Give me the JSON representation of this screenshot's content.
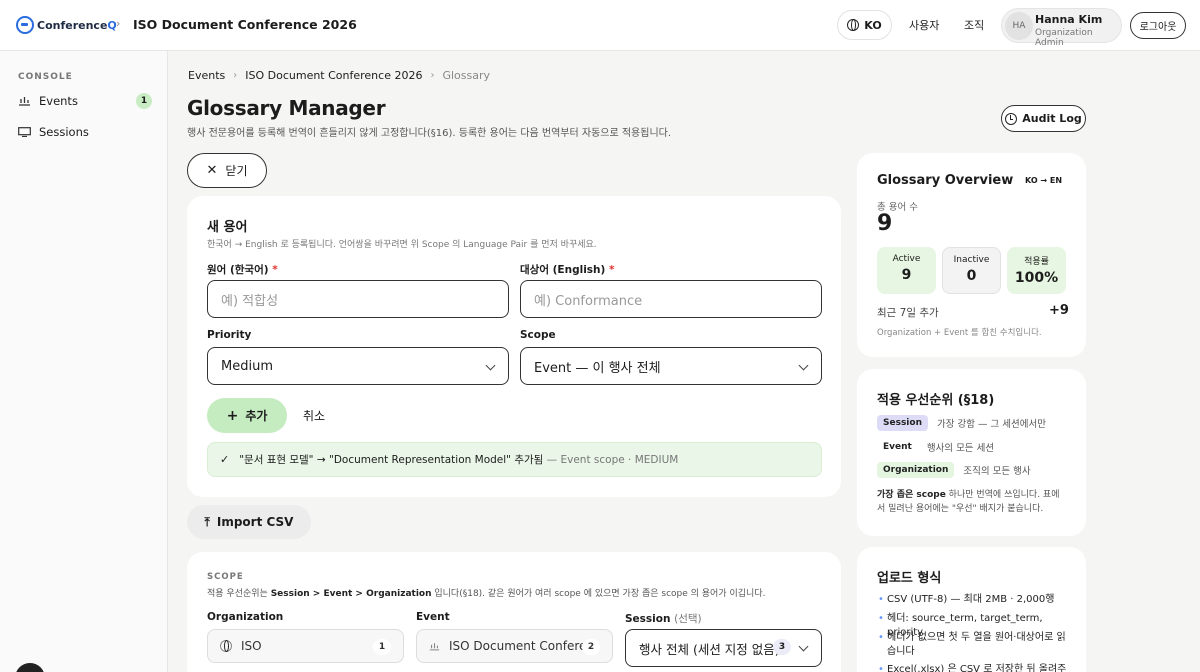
{
  "header": {
    "logo_main": "Conference",
    "logo_accent": "Q",
    "title": "ISO Document Conference 2026",
    "lang": "KO",
    "nav": [
      "사용자",
      "조직"
    ],
    "user": {
      "initials": "HA",
      "name": "Hanna Kim",
      "role": "Organization Admin"
    },
    "logout": "로그아웃"
  },
  "sidebar": {
    "heading": "CONSOLE",
    "items": [
      {
        "label": "Events",
        "badge": "1",
        "icon": "calendar-icon"
      },
      {
        "label": "Sessions",
        "icon": "monitor-icon"
      }
    ]
  },
  "breadcrumb": [
    "Events",
    "ISO Document Conference 2026",
    "Glossary"
  ],
  "page": {
    "title": "Glossary Manager",
    "subtitle": "행사 전문용어를 등록해 번역이 흔들리지 않게 고정합니다(§16). 등록한 용어는 다음 번역부터 자동으로 적용됩니다.",
    "audit_log": "Audit Log",
    "close": "닫기"
  },
  "new_term": {
    "title": "새 용어",
    "desc": "한국어 → English 로 등록됩니다. 언어쌍을 바꾸려면 위 Scope 의 Language Pair 를 먼저 바꾸세요.",
    "source_label": "원어 (한국어)",
    "source_placeholder": "예) 적합성",
    "target_label": "대상어 (English)",
    "target_placeholder": "예) Conformance",
    "required_mark": "*",
    "priority_label": "Priority",
    "priority_value": "Medium",
    "scope_label": "Scope",
    "scope_value": "Event — 이 행사 전체",
    "add": "추가",
    "cancel": "취소",
    "success": "\"문서 표현 모델\" → \"Document Representation Model\" 추가됨",
    "success_meta": "— Event scope · MEDIUM"
  },
  "import_csv": "Import CSV",
  "scope_section": {
    "heading": "SCOPE",
    "desc_prefix": "적용 우선순위는 ",
    "desc_bold": "Session > Event > Organization",
    "desc_suffix": " 입니다(§18). 같은 원어가 여러 scope 에 있으면 가장 좁은 scope 의 용어가 이깁니다.",
    "org_label": "Organization",
    "org_value": "ISO",
    "org_count": "1",
    "event_label": "Event",
    "event_value": "ISO Document Confere...",
    "event_count": "2",
    "session_label": "Session",
    "session_optional": "(선택)",
    "session_value": "행사 전체 (세션 지정 없음)",
    "session_count": "3"
  },
  "overview": {
    "title": "Glossary Overview",
    "pair": "KO → EN",
    "total_label": "총 용어 수",
    "total": "9",
    "stats": [
      {
        "label": "Active",
        "value": "9"
      },
      {
        "label": "Inactive",
        "value": "0"
      },
      {
        "label": "적용률",
        "value": "100%"
      }
    ],
    "recent_label": "최근 7일 추가",
    "recent_value": "+9",
    "note": "Organization + Event 를 합친 수치입니다."
  },
  "priority_panel": {
    "title": "적용 우선순위 (§18)",
    "rows": [
      {
        "tag": "Session",
        "desc": "가장 강함 — 그 세션에서만",
        "color": "#dcdcf7"
      },
      {
        "tag": "Event",
        "desc": "행사의 모든 세션",
        "color": "#ffffff"
      },
      {
        "tag": "Organization",
        "desc": "조직의 모든 행사",
        "color": "#e4f5e0"
      }
    ],
    "note_bold": "가장 좁은 scope",
    "note_rest": " 하나만 번역에 쓰입니다. 표에서 밀려난 용어에는 \"우선\" 배지가 붙습니다."
  },
  "upload_panel": {
    "title": "업로드 형식",
    "bullets": [
      "CSV (UTF-8) — 최대 2MB · 2,000행",
      "헤더: source_term, target_term, priority",
      "헤더가 없으면 첫 두 열을 원어·대상어로 읽습니다",
      "Excel(.xlsx) 은 CSV 로 저장한 뒤 올려주세"
    ]
  },
  "colors": {
    "accent": "#2b6cdf",
    "success_bg": "#c5ecc0",
    "danger": "#dd3333"
  }
}
